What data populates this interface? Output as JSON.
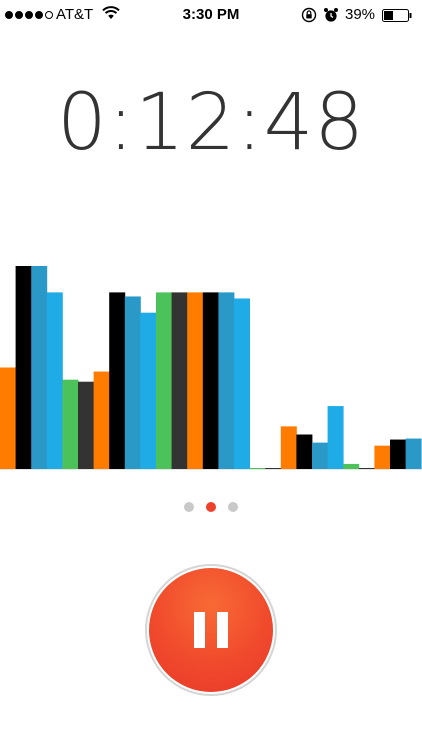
{
  "status_bar": {
    "carrier": "AT&T",
    "time": "3:30 PM",
    "battery_percent": "39%",
    "signal_bars_filled": 4,
    "signal_bars_total": 5,
    "battery_level": 0.39,
    "icons": [
      "wifi-icon",
      "rotation-lock-icon",
      "alarm-icon",
      "battery-icon"
    ]
  },
  "timer": {
    "value": "0:12:48"
  },
  "waveform": {
    "colors": {
      "orange": "#ff7c00",
      "black": "#000000",
      "teal": "#2a99c7",
      "blue": "#1fabe6",
      "green": "#4cc25b",
      "darkgray": "#333333",
      "lightblue": "#34b2ec"
    },
    "bars": [
      {
        "c": "orange",
        "v": 0.5
      },
      {
        "c": "black",
        "v": 1.0
      },
      {
        "c": "teal",
        "v": 1.0
      },
      {
        "c": "blue",
        "v": 0.87
      },
      {
        "c": "green",
        "v": 0.44
      },
      {
        "c": "darkgray",
        "v": 0.43
      },
      {
        "c": "orange",
        "v": 0.48
      },
      {
        "c": "black",
        "v": 0.87
      },
      {
        "c": "teal",
        "v": 0.85
      },
      {
        "c": "blue",
        "v": 0.77
      },
      {
        "c": "green",
        "v": 0.87
      },
      {
        "c": "darkgray",
        "v": 0.87
      },
      {
        "c": "orange",
        "v": 0.87
      },
      {
        "c": "black",
        "v": 0.87
      },
      {
        "c": "teal",
        "v": 0.87
      },
      {
        "c": "blue",
        "v": 0.84
      },
      {
        "c": "green",
        "v": 0.005
      },
      {
        "c": "darkgray",
        "v": 0.005
      },
      {
        "c": "orange",
        "v": 0.21
      },
      {
        "c": "black",
        "v": 0.17
      },
      {
        "c": "teal",
        "v": 0.13
      },
      {
        "c": "blue",
        "v": 0.31
      },
      {
        "c": "green",
        "v": 0.025
      },
      {
        "c": "darkgray",
        "v": 0.005
      },
      {
        "c": "orange",
        "v": 0.115
      },
      {
        "c": "black",
        "v": 0.145
      },
      {
        "c": "teal",
        "v": 0.15
      }
    ]
  },
  "pager": {
    "count": 3,
    "active_index": 1
  },
  "controls": {
    "pause_button": "pause",
    "pause_color": "#f04a2c"
  }
}
